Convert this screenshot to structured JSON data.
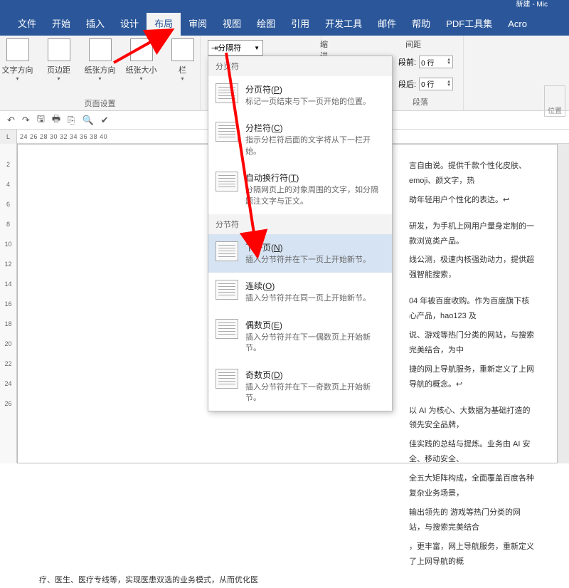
{
  "titlebar": {
    "text": "新建 - Mic"
  },
  "menubar": {
    "tabs": [
      "文件",
      "开始",
      "插入",
      "设计",
      "布局",
      "审阅",
      "视图",
      "绘图",
      "引用",
      "开发工具",
      "邮件",
      "帮助",
      "PDF工具集",
      "Acro"
    ],
    "active_index": 4
  },
  "ribbon": {
    "buttons": {
      "text_direction": "文字方向",
      "margins": "页边距",
      "orientation": "纸张方向",
      "size": "纸张大小",
      "columns": "栏"
    },
    "page_setup_label": "页面设置",
    "breaks_label": "分隔符",
    "indent_label": "缩进",
    "spacing_label": "间距",
    "before_label": "段前:",
    "after_label": "段后:",
    "before_value": "0 行",
    "after_value": "0 行",
    "paragraph_label": "段落",
    "position_label": "位置"
  },
  "qat": {
    "undo": "↶",
    "redo": "↷",
    "save": "🖫",
    "print": "🖶",
    "clipboard": "⎘",
    "find": "🔍",
    "task": "✔"
  },
  "ruler": {
    "corner": "L",
    "top_values": "                                                    24   26   28   30   32   34   36   38   40"
  },
  "vruler": [
    "2",
    "4",
    "6",
    "8",
    "10",
    "12",
    "14",
    "16",
    "18",
    "20",
    "22",
    "24",
    "26"
  ],
  "menu": {
    "section_page": "分页符",
    "section_section": "分节符",
    "items": {
      "page_break": {
        "title_pre": "分页符(",
        "key": "P",
        "title_post": ")",
        "desc": "标记一页结束与下一页开始的位置。"
      },
      "column_break": {
        "title_pre": "分栏符(",
        "key": "C",
        "title_post": ")",
        "desc": "指示分栏符后面的文字将从下一栏开始。"
      },
      "text_wrap": {
        "title_pre": "自动换行符(",
        "key": "T",
        "title_post": ")",
        "desc": "分隔网页上的对象周围的文字，如分隔题注文字与正文。"
      },
      "next_page": {
        "title_pre": "下一页(",
        "key": "N",
        "title_post": ")",
        "desc": "插入分节符并在下一页上开始新节。"
      },
      "continuous": {
        "title_pre": "连续(",
        "key": "O",
        "title_post": ")",
        "desc": "插入分节符并在同一页上开始新节。"
      },
      "even_page": {
        "title_pre": "偶数页(",
        "key": "E",
        "title_post": ")",
        "desc": "插入分节符并在下一偶数页上开始新节。"
      },
      "odd_page": {
        "title_pre": "奇数页(",
        "key": "D",
        "title_post": ")",
        "desc": "插入分节符并在下一奇数页上开始新节。"
      }
    }
  },
  "document": {
    "lines": [
      "言自由说。提供千款个性化皮肤、emoji、颜文字，热",
      "助年轻用户个性化的表达。↩",
      "研发，为手机上网用户量身定制的一款浏览类产品。",
      "线公测，极速内核强劲动力，提供超强智能搜索，",
      "04 年被百度收购。作为百度旗下核心产品，hao123 及",
      "说、游戏等热门分类的网站，与搜索完美结合，为中",
      "捷的网上导航服务，重新定义了上网导航的概念。↩",
      "以 AI 为核心、大数据为基础打造的领先安全品牌，",
      "佳实践的总结与提炼。业务由 AI 安全、移动安全、",
      "全五大矩阵构成，全面覆盖百度各种复杂业务场景，",
      "输出领先的                        游戏等热门分类的网站，与搜索完美结合",
      "，更丰富，网上导航服务，重新定义了上网导航的概",
      "疗、医生、医疗专线等，实现医患双选的业务模式，从而优化医"
    ]
  }
}
